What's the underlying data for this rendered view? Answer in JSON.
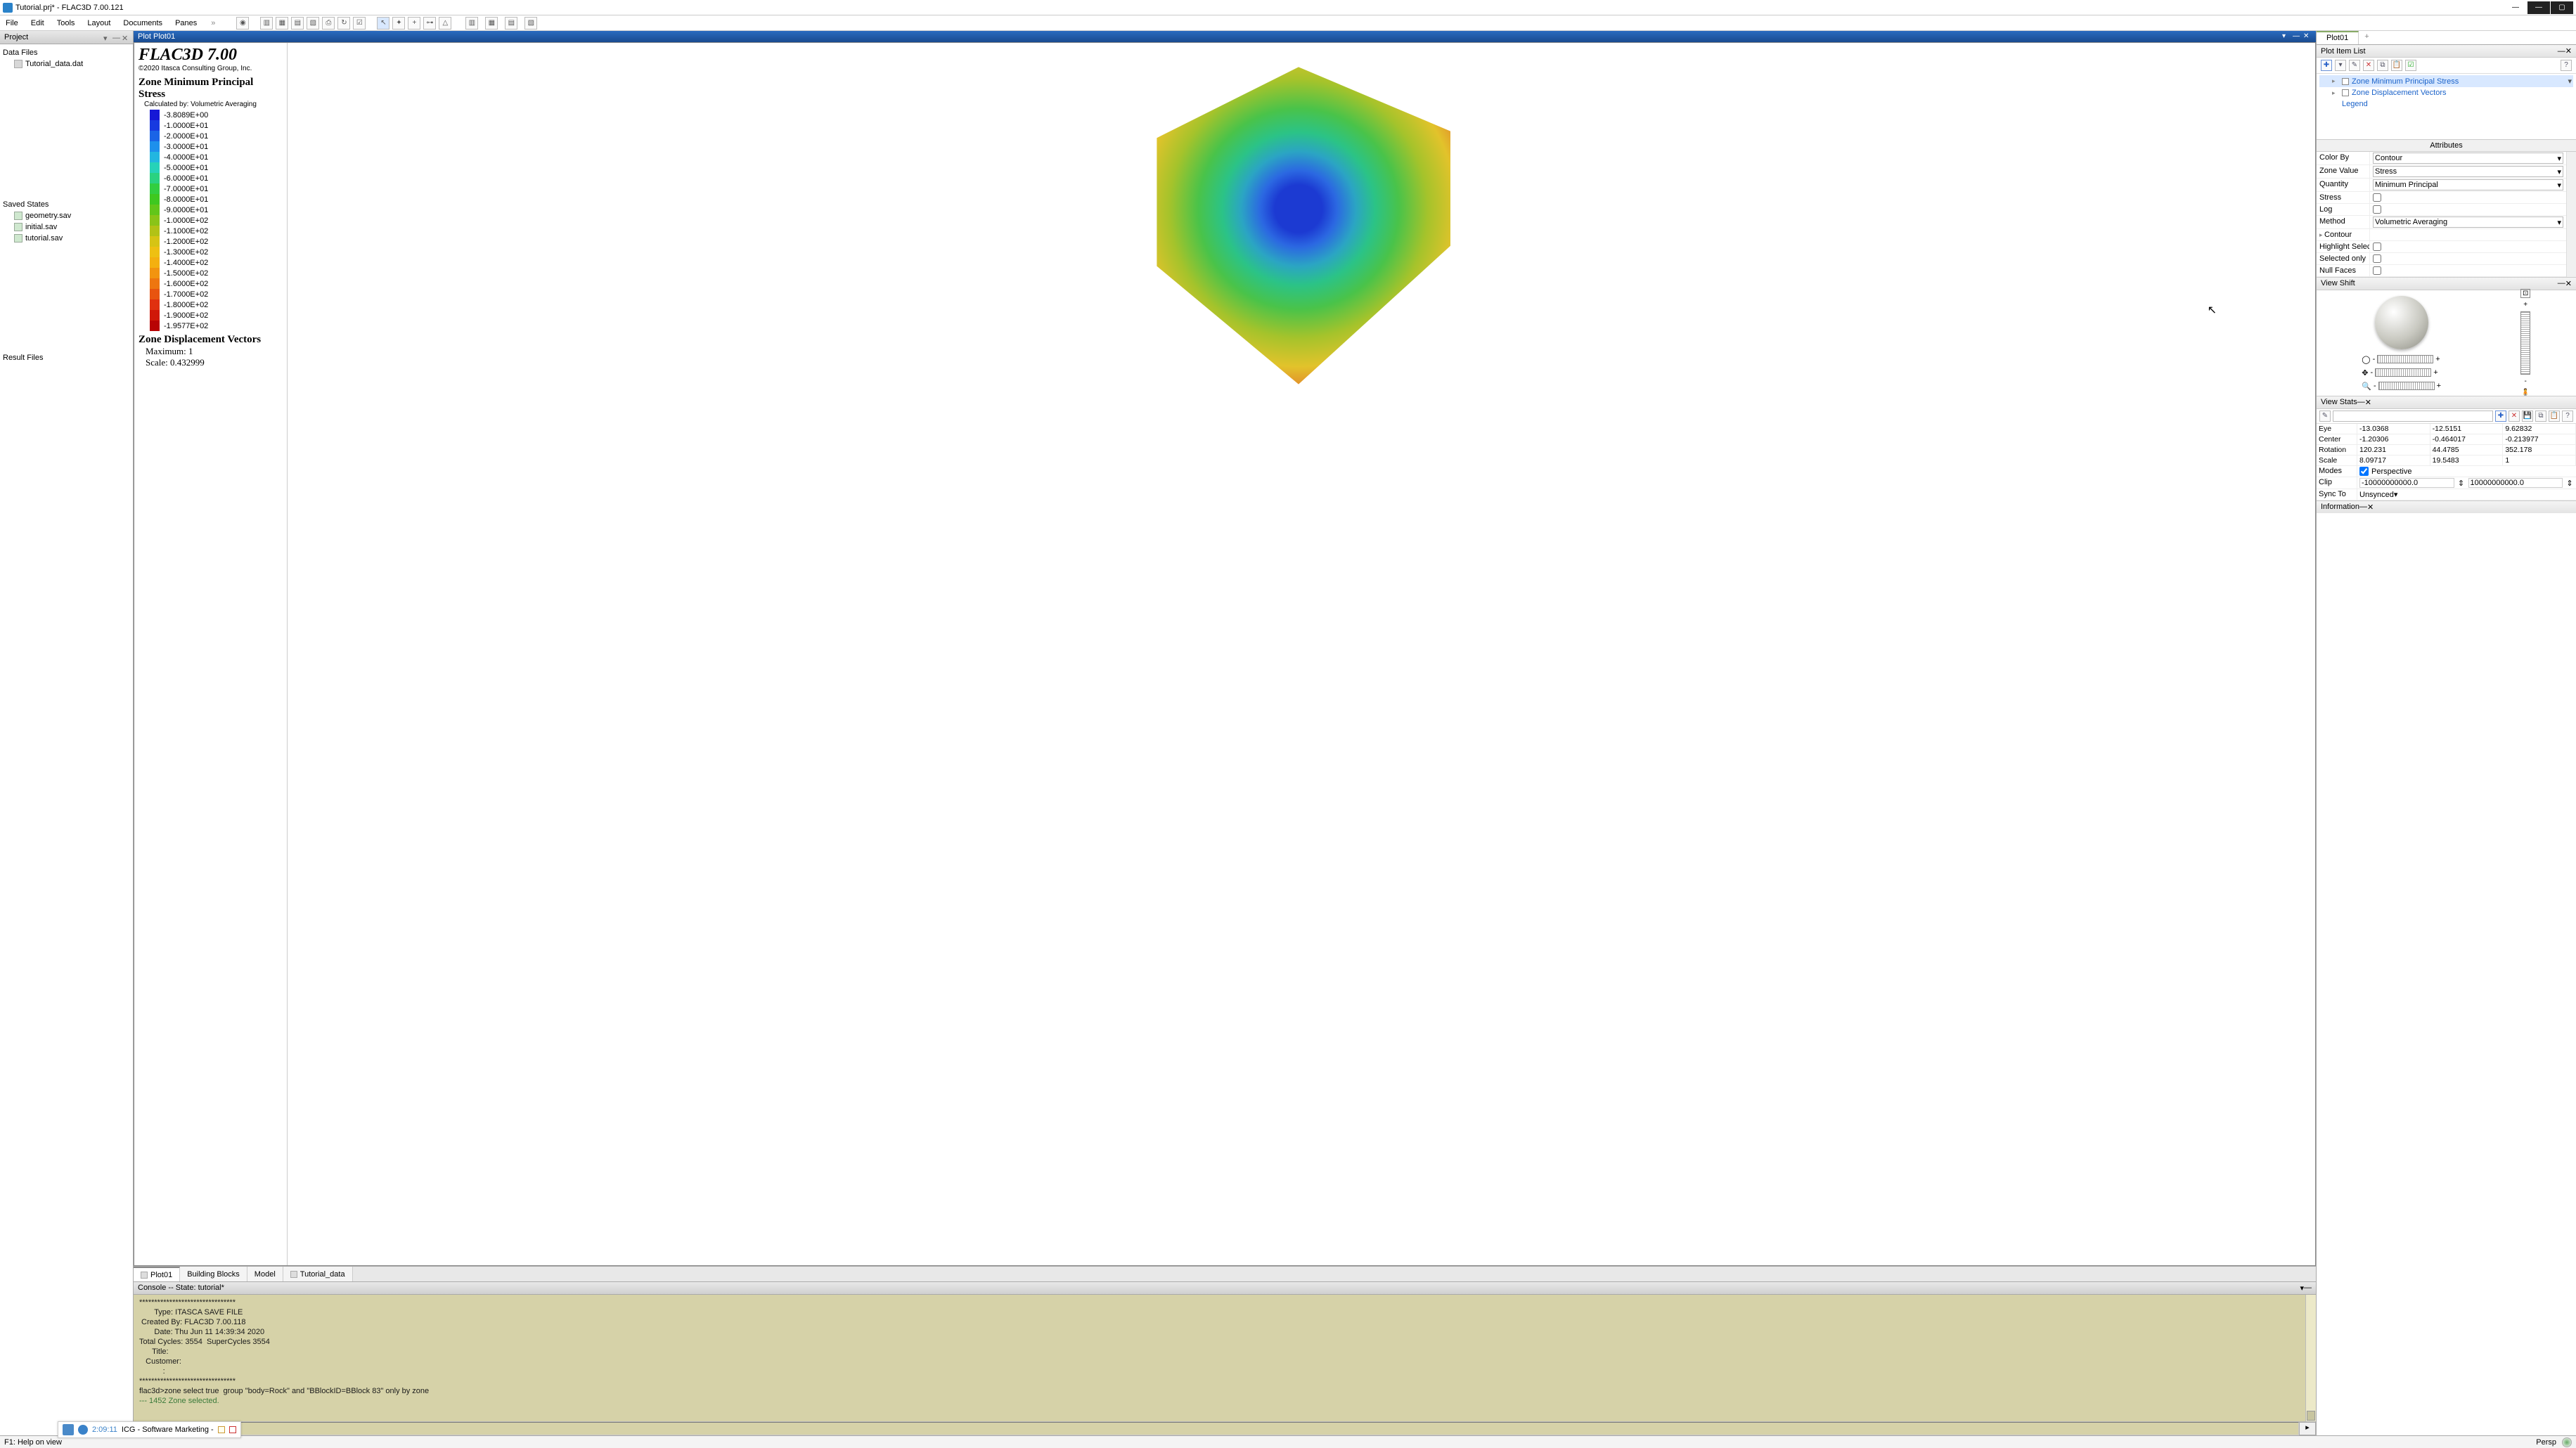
{
  "window": {
    "title": "Tutorial.prj* - FLAC3D 7.00.121"
  },
  "menus": [
    "File",
    "Edit",
    "Tools",
    "Layout",
    "Documents",
    "Panes"
  ],
  "project_pane": {
    "title": "Project",
    "sections": {
      "data_files": "Data Files",
      "saved_states": "Saved States",
      "result_files": "Result Files"
    },
    "data_files": [
      "Tutorial_data.dat"
    ],
    "saved_states": [
      "geometry.sav",
      "initial.sav",
      "tutorial.sav"
    ]
  },
  "plot_header": "Plot Plot01",
  "legend": {
    "app_title": "FLAC3D 7.00",
    "copyright": "©2020 Itasca Consulting Group, Inc.",
    "section1": "Zone Minimum Principal Stress",
    "calc_by": "Calculated by: Volumetric Averaging",
    "entries": [
      {
        "c": "#1618d6",
        "v": "-3.8089E+00"
      },
      {
        "c": "#173ae0",
        "v": "-1.0000E+01"
      },
      {
        "c": "#1a64e6",
        "v": "-2.0000E+01"
      },
      {
        "c": "#1e90ec",
        "v": "-3.0000E+01"
      },
      {
        "c": "#22b6e0",
        "v": "-4.0000E+01"
      },
      {
        "c": "#26d2b8",
        "v": "-5.0000E+01"
      },
      {
        "c": "#2ad280",
        "v": "-6.0000E+01"
      },
      {
        "c": "#32ce40",
        "v": "-7.0000E+01"
      },
      {
        "c": "#3ec820",
        "v": "-8.0000E+01"
      },
      {
        "c": "#62c61a",
        "v": "-9.0000E+01"
      },
      {
        "c": "#8ac418",
        "v": "-1.0000E+02"
      },
      {
        "c": "#b2c216",
        "v": "-1.1000E+02"
      },
      {
        "c": "#d6c414",
        "v": "-1.2000E+02"
      },
      {
        "c": "#eec012",
        "v": "-1.3000E+02"
      },
      {
        "c": "#f4b010",
        "v": "-1.4000E+02"
      },
      {
        "c": "#f29410",
        "v": "-1.5000E+02"
      },
      {
        "c": "#ee7610",
        "v": "-1.6000E+02"
      },
      {
        "c": "#e85410",
        "v": "-1.7000E+02"
      },
      {
        "c": "#e03010",
        "v": "-1.8000E+02"
      },
      {
        "c": "#d01808",
        "v": "-1.9000E+02"
      },
      {
        "c": "#b80404",
        "v": "-1.9577E+02"
      }
    ],
    "section2": "Zone Displacement Vectors",
    "disp_max": "Maximum: 1",
    "disp_scale": "Scale: 0.432999"
  },
  "plot_tabs": [
    {
      "label": "Plot01",
      "icon": true,
      "active": true
    },
    {
      "label": "Building Blocks"
    },
    {
      "label": "Model"
    },
    {
      "label": "Tutorial_data",
      "icon": true
    }
  ],
  "console_header": "Console -- State: tutorial*",
  "console_lines": [
    "********************************",
    "       Type: ITASCA SAVE FILE",
    " Created By: FLAC3D 7.00.118",
    "       Date: Thu Jun 11 14:39:34 2020",
    "Total Cycles: 3554  SuperCycles 3554",
    "      Title:",
    "   Customer:",
    "           :",
    "********************************",
    "flac3d>zone select true  group \"body=Rock\" and \"BBlockID=BBlock 83\" only by zone"
  ],
  "console_last": "--- 1452 Zone selected.",
  "right_pane": {
    "plot_tab": "Plot01",
    "item_list_header": "Plot Item List",
    "items": [
      {
        "label": "Zone Minimum Principal Stress",
        "selected": true,
        "expandable": true
      },
      {
        "label": "Zone Displacement Vectors",
        "expandable": true
      },
      {
        "label": "Legend"
      }
    ],
    "attributes_header": "Attributes",
    "attrs": {
      "color_by": {
        "k": "Color By",
        "v": "Contour"
      },
      "zone_value": {
        "k": "Zone Value",
        "v": "Stress"
      },
      "quantity": {
        "k": "Quantity",
        "v": "Minimum Principal"
      },
      "stress": {
        "k": "Stress"
      },
      "log": {
        "k": "Log"
      },
      "method": {
        "k": "Method",
        "v": "Volumetric Averaging"
      },
      "contour": {
        "k": "Contour"
      },
      "highlight": {
        "k": "Highlight Select"
      },
      "selected_only": {
        "k": "Selected only"
      },
      "null_faces": {
        "k": "Null Faces"
      }
    },
    "view_shift_header": "View Shift",
    "view_stats_header": "View Stats",
    "stats": {
      "eye": {
        "k": "Eye",
        "a": "-13.0368",
        "b": "-12.5151",
        "c": "9.62832"
      },
      "center": {
        "k": "Center",
        "a": "-1.20306",
        "b": "-0.464017",
        "c": "-0.213977"
      },
      "rotation": {
        "k": "Rotation",
        "a": "120.231",
        "b": "44.4785",
        "c": "352.178"
      },
      "scale": {
        "k": "Scale",
        "a": "8.09717",
        "b": "19.5483",
        "c": "1"
      },
      "modes": {
        "k": "Modes",
        "v": "Perspective"
      },
      "clip": {
        "k": "Clip",
        "a": "-10000000000.0",
        "b": "10000000000.0"
      },
      "sync": {
        "k": "Sync To",
        "v": "Unsynced"
      }
    },
    "information_header": "Information"
  },
  "statusbar": {
    "help": "F1: Help on view",
    "right": "Persp"
  },
  "taskbar": {
    "time": "2:09:11",
    "label": "ICG - Software Marketing -"
  }
}
